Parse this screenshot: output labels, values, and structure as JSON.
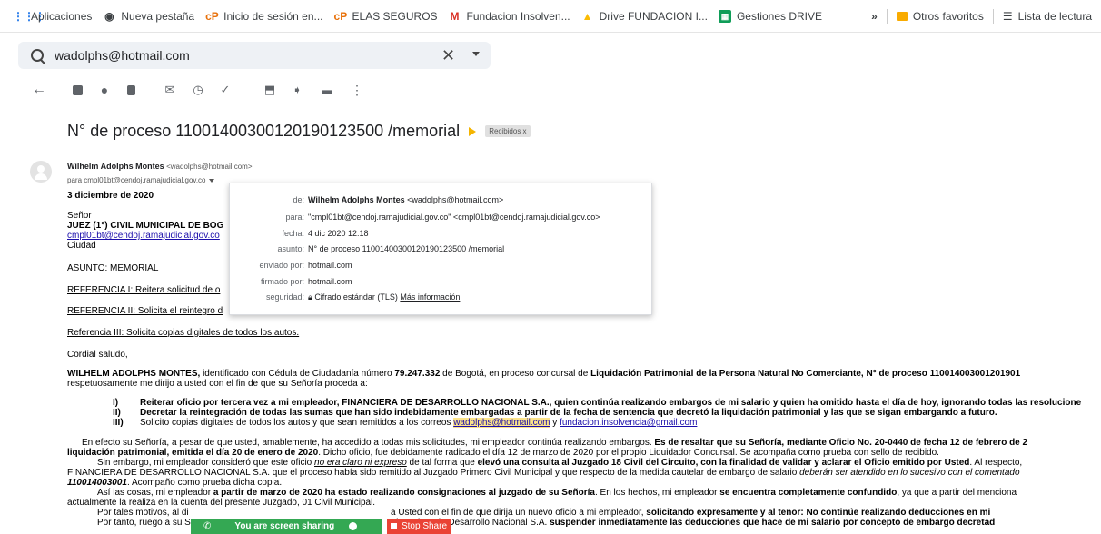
{
  "bookmarks": {
    "items": [
      {
        "label": "Aplicaciones",
        "icon": "apps-grid-icon"
      },
      {
        "label": "Nueva pestaña",
        "icon": "chrome-icon"
      },
      {
        "label": "Inicio de sesión en...",
        "icon": "cp-logo-icon"
      },
      {
        "label": "ELAS SEGUROS",
        "icon": "cp-logo-icon"
      },
      {
        "label": "Fundacion Insolven...",
        "icon": "gmail-icon"
      },
      {
        "label": "Drive FUNDACION I...",
        "icon": "drive-icon"
      },
      {
        "label": "Gestiones DRIVE",
        "icon": "sheets-icon"
      }
    ],
    "more": "»",
    "other": "Otros favoritos",
    "reading": "Lista de lectura"
  },
  "search": {
    "value": "wadolphs@hotmail.com"
  },
  "subject": {
    "title": "N° de proceso 110014003001201901235​00 /memorial",
    "label": "Recibidos x"
  },
  "sender": {
    "name": "Wilhelm Adolphs Montes",
    "email": "<wadolphs@hotmail.com>",
    "to": "para cmpl01bt@cendoj.ramajudicial.gov.co"
  },
  "details": {
    "de_k": "de:",
    "de_name": "Wilhelm Adolphs Montes",
    "de_email": "<wadolphs@hotmail.com>",
    "para_k": "para:",
    "para_v": "\"cmpl01bt@cendoj.ramajudicial.gov.co\" <cmpl01bt@cendoj.ramajudicial.gov.co>",
    "fecha_k": "fecha:",
    "fecha_v": "4 dic 2020 12:18",
    "asunto_k": "asunto:",
    "asunto_v": "N° de proceso 11001400300120190123500 /memorial",
    "enviado_k": "enviado por:",
    "enviado_v": "hotmail.com",
    "firmado_k": "firmado por:",
    "firmado_v": "hotmail.com",
    "seg_k": "seguridad:",
    "seg_v": "Cifrado estándar (TLS)",
    "seg_link": "Más información"
  },
  "body": {
    "date": "3 diciembre de 2020",
    "senor": "Señor",
    "juez": "JUEZ (1°) CIVIL MUNICIPAL DE BOG",
    "email": "cmpl01bt@cendoj.ramajudicial.gov.co",
    "ciudad": "Ciudad",
    "asunto": "ASUNTO: MEMORIAL",
    "ref1": "REFERENCIA I: Reitera solicitud de o",
    "ref2": "REFERENCIA II: Solicita el reintegro d",
    "ref3": "Referencia III: Solicita copias digitales de todos los autos.",
    "cordial": "Cordial saludo,",
    "p1a": "WILHELM ADOLPHS MONTES,",
    "p1b": " identificado con Cédula de Ciudadanía número ",
    "p1c": "79.247.332",
    "p1d": " de Bogotá, en proceso concursal de ",
    "p1e": "Liquidación Patrimonial de la Persona Natural No Comerciante, N° de proceso 110014003001201901",
    "p1f": "respetuosamente me dirijo a usted con el fin de que su Señoría proceda a:",
    "li1_n": "I)",
    "li1": "Reiterar oficio por tercera vez a mi empleador, FINANCIERA DE DESARROLLO NACIONAL S.A., quien continúa realizando embargos de mi salario y quien ha omitido hasta el día de hoy, ignorando todas las resolucione",
    "li2_n": "II)",
    "li2": "Decretar la reintegración de todas las sumas que han sido indebidamente embargadas a partir de la fecha de sentencia que decretó la liquidación patrimonial y las que se sigan embargando a futuro.",
    "li3_n": "III)",
    "li3": "Solicito copias digitales de todos los autos y que sean remitidos a los correos ",
    "li3_e1": "wadolphs@hotmail.com",
    "li3_y": " y ",
    "li3_e2": "fundacion.insolvencia@gmail.com",
    "p2a": "En efecto su Señoría, a pesar de que usted, amablemente, ha accedido a todas mis solicitudes, mi empleador continúa realizando embargos. ",
    "p2b": "Es de resaltar que su Señoría, mediante Oficio No. 20-0440 de fecha 12 de febrero de 2",
    "p2c": "liquidación patrimonial, emitida el día 20 de enero de 2020",
    "p2d": ". Dicho oficio, fue debidamente radicado el día 12 de marzo de 2020 por el propio Liquidador Concursal. Se acompaña como prueba con sello de recibido.",
    "p3a": "Sin embargo, mi empleador consideró que este oficio ",
    "p3b": "no era claro ni expreso",
    "p3c": " de tal forma que ",
    "p3d": "elevó una consulta al Juzgado 18 Civil del Circuito, con la finalidad de validar y aclarar el Oficio emitido por Usted",
    "p3e": ". Al respecto,",
    "p3f": "FINANCIERA DE DESARROLLO NACIONAL S.A. que el proceso había sido remitido al Juzgado Primero Civil Municipal y que respecto de la medida cautelar de embargo de salario ",
    "p3g": "deberán ser atendido en lo sucesivo con el comentado",
    "p3h": "110014003001",
    "p3i": ". Acompaño como prueba dicha copia.",
    "p4a": "Así las cosas, mi empleador ",
    "p4b": "a partir de marzo de 2020 ha estado realizando consignaciones al juzgado de su Señoría",
    "p4c": ". En los hechos, mi empleador ",
    "p4d": "se encuentra completamente confundido",
    "p4e": ", ya que a partir del menciona",
    "p4f": "actualmente la realiza en la cuenta del presente Juzgado, 01 Civil Municipal.",
    "p5a": "Por tales motivos, al di",
    "p5b": "a Usted con el fin de que dirija un nuevo oficio a mi empleador, ",
    "p5c": "solicitando expresamente y al tenor: No continúe realizando deducciones en mi",
    "p6a": "Por tanto, ruego a su S",
    "p6b": "Financiera de Desarrollo Nacional S.A. ",
    "p6c": "suspender inmediatamente las deducciones que hace de mi salario por concepto de embargo decretad"
  },
  "share": {
    "text": "You are screen sharing",
    "stop": "Stop Share"
  }
}
